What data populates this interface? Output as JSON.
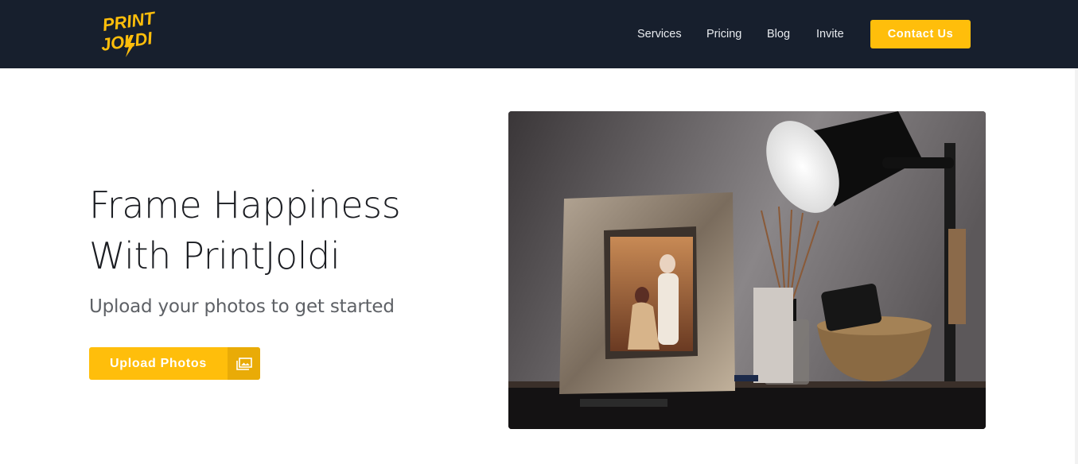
{
  "brand": {
    "logo_line1": "PRINT",
    "logo_line2": "JOLDI",
    "accent_color": "#ffbe0b",
    "header_color": "#171f2d"
  },
  "nav": {
    "items": [
      {
        "label": "Services"
      },
      {
        "label": "Pricing"
      },
      {
        "label": "Blog"
      },
      {
        "label": "Invite"
      }
    ],
    "contact_label": "Contact Us"
  },
  "hero": {
    "title_line1": "Frame Happiness",
    "title_line2": "With PrintJoldi",
    "subtitle": "Upload your photos to get started",
    "upload_label": "Upload Photos",
    "upload_icon": "photos-icon",
    "image_icon": "framed-photo-on-table"
  }
}
